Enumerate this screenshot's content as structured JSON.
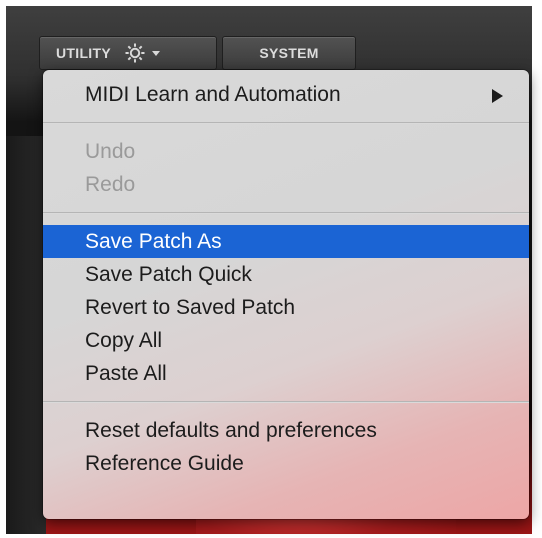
{
  "toolbar": {
    "utility_label": "UTILITY",
    "system_label": "SYSTEM"
  },
  "menu": {
    "midi_learn": "MIDI Learn and Automation",
    "undo": "Undo",
    "redo": "Redo",
    "save_patch_as": "Save Patch As",
    "save_patch_quick": "Save Patch Quick",
    "revert": "Revert to Saved Patch",
    "copy_all": "Copy All",
    "paste_all": "Paste All",
    "reset_defaults": "Reset defaults and preferences",
    "reference_guide": "Reference Guide"
  },
  "icons": {
    "settings": "gear-icon",
    "dropdown": "caret-down-icon",
    "submenu": "submenu-arrow-icon"
  },
  "colors": {
    "selection": "#1b64d4",
    "disabled_text": "#9a9a9a",
    "menu_text": "#1c1c1c"
  }
}
